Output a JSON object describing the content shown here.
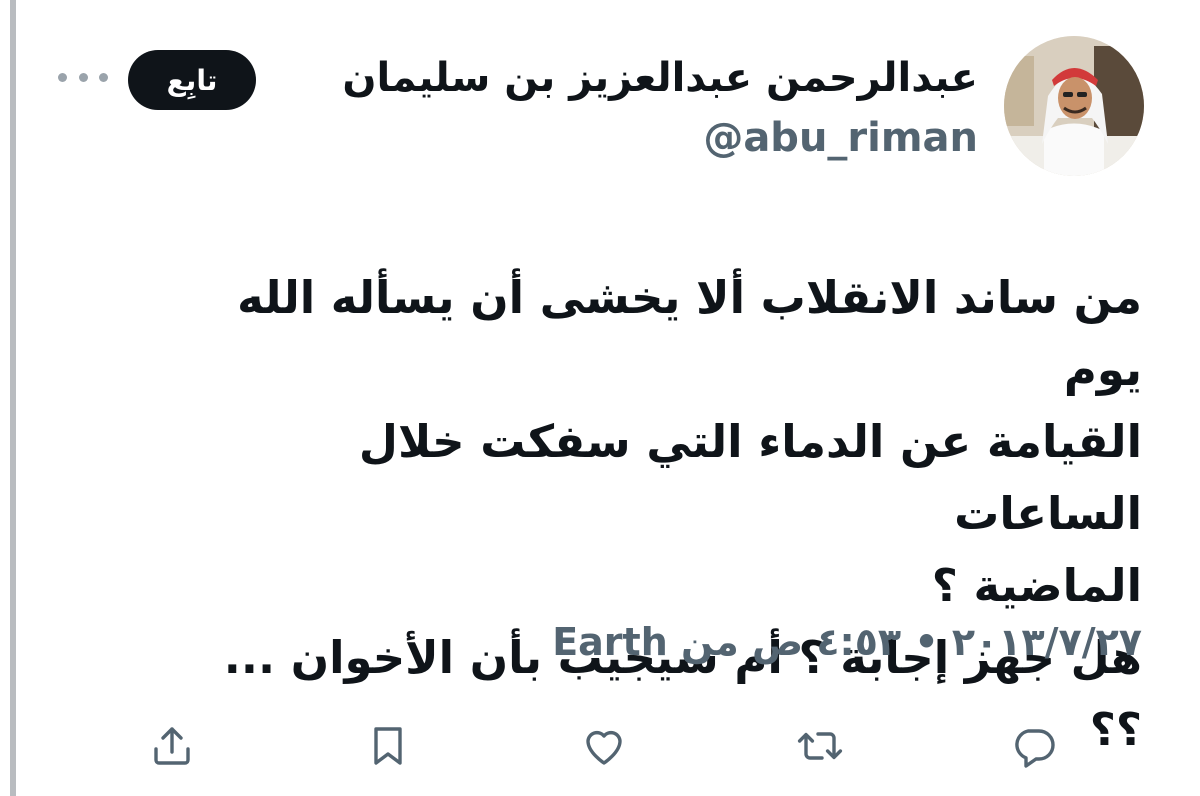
{
  "tweet": {
    "author": {
      "display_name": "عبدالرحمن عبدالعزيز بن سليمان",
      "handle": "@abu_riman"
    },
    "follow_label": "تابِع",
    "text": "من ساند الانقلاب ألا يخشى أن يسأله الله يوم\nالقيامة عن الدماء التي سفكت خلال الساعات\nالماضية ؟\nهل جهز إجابة ؟ أم سيجيب بأن الأخوان ... ؟؟",
    "date": "٢٠١٣/٧/٢٧",
    "time": "٤:٥٣ ص",
    "separator": "•",
    "source_prefix": "من",
    "source": "Earth"
  },
  "actions": [
    {
      "name": "reply",
      "icon": "reply-icon"
    },
    {
      "name": "retweet",
      "icon": "retweet-icon"
    },
    {
      "name": "like",
      "icon": "heart-icon"
    },
    {
      "name": "bookmark",
      "icon": "bookmark-icon"
    },
    {
      "name": "share",
      "icon": "share-icon"
    }
  ],
  "colors": {
    "text_primary": "#0f1419",
    "text_secondary": "#536471",
    "button_bg": "#0f1419"
  }
}
